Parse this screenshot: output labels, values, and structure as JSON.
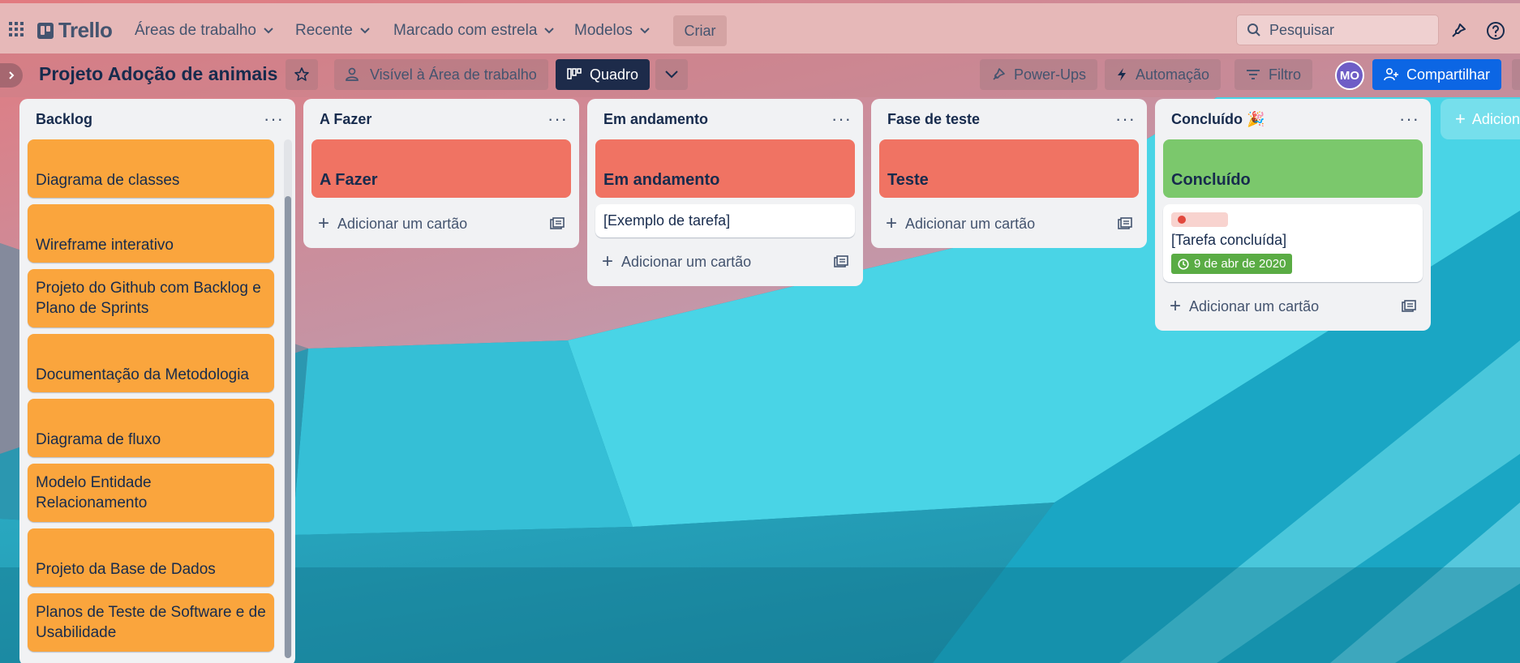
{
  "topbar": {
    "brand": "Trello",
    "nav": [
      {
        "label": "Áreas de trabalho"
      },
      {
        "label": "Recente"
      },
      {
        "label": "Marcado com estrela"
      },
      {
        "label": "Modelos"
      }
    ],
    "create_label": "Criar",
    "search_placeholder": "Pesquisar"
  },
  "board": {
    "title": "Projeto Adoção de animais",
    "visibility_label": "Visível à Área de trabalho",
    "view_label": "Quadro",
    "powerups_label": "Power-Ups",
    "automation_label": "Automação",
    "filter_label": "Filtro",
    "avatar_initials": "MO",
    "share_label": "Compartilhar",
    "add_list_label": "Adicion"
  },
  "lists": [
    {
      "title": "Backlog",
      "cards": [
        "Diagrama de classes",
        "Wireframe interativo",
        "Projeto do Github com Backlog e Plano de Sprints",
        "Documentação da Metodologia",
        "Diagrama de fluxo",
        "Modelo Entidade Relacionamento",
        "Projeto da Base de Dados",
        "Planos de Teste de Software e de Usabilidade"
      ]
    },
    {
      "title": "A Fazer",
      "cover_title": "A Fazer",
      "add_label": "Adicionar um cartão"
    },
    {
      "title": "Em andamento",
      "cover_title": "Em andamento",
      "task": "[Exemplo de tarefa]",
      "add_label": "Adicionar um cartão"
    },
    {
      "title": "Fase de teste",
      "cover_title": "Teste",
      "add_label": "Adicionar um cartão"
    },
    {
      "title": "Concluído 🎉",
      "cover_title": "Concluído",
      "task": "[Tarefa concluída]",
      "due": "9 de abr de 2020",
      "add_label": "Adicionar um cartão"
    }
  ],
  "colors": {
    "header_bg": "#e6b8b8",
    "orange_card": "#faa53d",
    "red_cover": "#f07363",
    "green_cover": "#7bc86c",
    "share_blue": "#0c66e4",
    "quadro_dark": "#1d2b4a"
  }
}
